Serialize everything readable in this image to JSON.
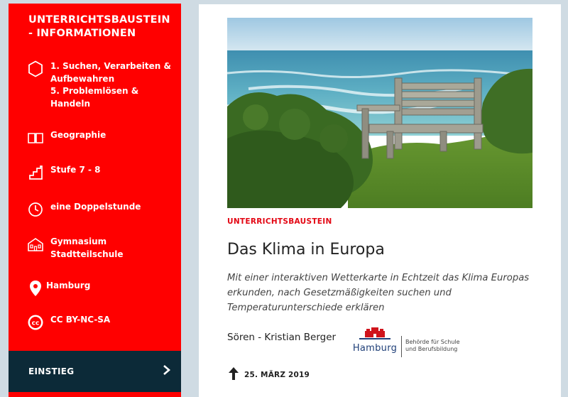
{
  "sidebar": {
    "title": "UNTERRICHTSBAUSTEIN - INFORMATIONEN",
    "items": [
      {
        "icon": "hexagon-icon",
        "lines": [
          "1. Suchen, Verarbeiten &",
          "Aufbewahren",
          "5. Problemlösen &",
          "Handeln"
        ]
      },
      {
        "icon": "book-icon",
        "lines": [
          "Geographie"
        ]
      },
      {
        "icon": "stairs-icon",
        "lines": [
          "Stufe 7 - 8"
        ]
      },
      {
        "icon": "clock-icon",
        "lines": [
          "eine Doppelstunde"
        ]
      },
      {
        "icon": "school-building-icon",
        "lines": [
          "Gymnasium",
          "Stadtteilschule"
        ]
      },
      {
        "icon": "location-pin-icon",
        "lines": [
          "Hamburg"
        ]
      },
      {
        "icon": "creative-commons-icon",
        "lines": [
          "CC BY-NC-SA"
        ]
      }
    ],
    "einstieg_label": "EINSTIEG"
  },
  "article": {
    "kicker": "UNTERRICHTSBAUSTEIN",
    "title": "Das Klima in Europa",
    "subtitle_lines": [
      "Mit einer interaktiven Wetterkarte in Echtzeit das Klima Europas",
      "erkunden, nach Gesetzmäßigkeiten suchen und",
      "Temperaturunterschiede erklären"
    ],
    "author": "Sören - Kristian Berger",
    "logo": {
      "word": "Hamburg",
      "agency_line1": "Behörde für Schule",
      "agency_line2": "und Berufsbildung"
    },
    "date": "25. MÄRZ 2019"
  },
  "colors": {
    "sidebar_red": "#ff0000",
    "einstieg_dark": "#0c2a38",
    "kicker_red": "#e30613",
    "background": "#cfdbe3"
  }
}
